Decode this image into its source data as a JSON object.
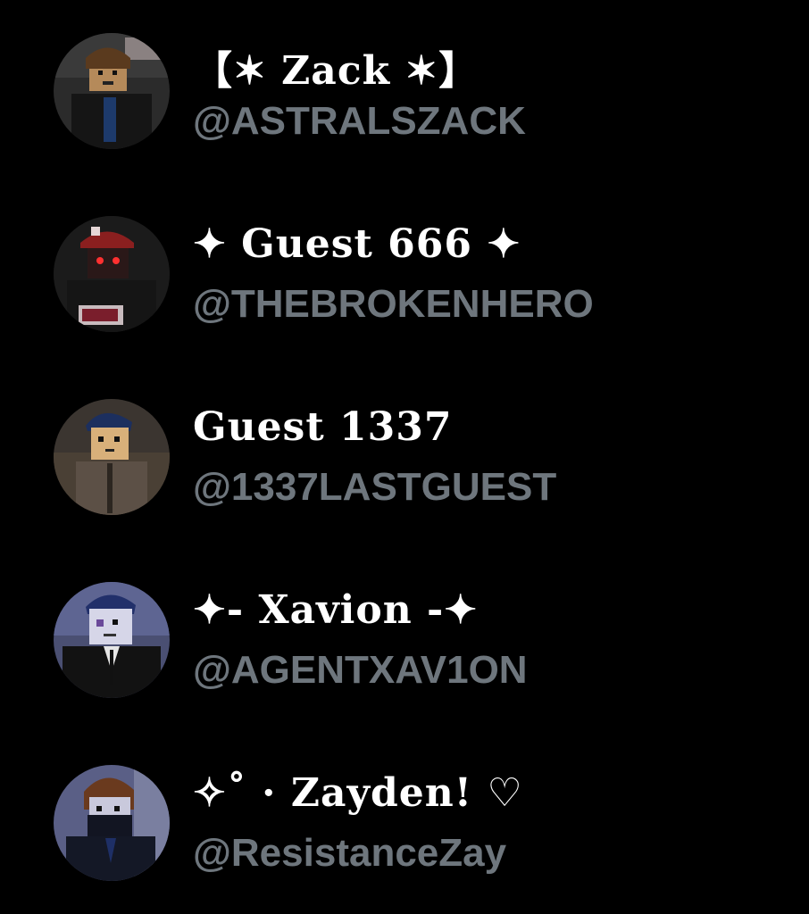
{
  "accounts": [
    {
      "display_name": "【✶ Zack ✶】",
      "handle": "@ASTRALSZACK",
      "avatar": "avatar-roblox-brown-hair"
    },
    {
      "display_name": "✦ Guest 666 ✦",
      "handle": "@THEBROKENHERO",
      "avatar": "avatar-roblox-red-cap"
    },
    {
      "display_name": "Guest 1337",
      "handle": "@1337LASTGUEST",
      "avatar": "avatar-roblox-blue-hair"
    },
    {
      "display_name": "✦- Xavion -✦",
      "handle": "@AGENTXAV1ON",
      "avatar": "avatar-roblox-agent-suit"
    },
    {
      "display_name": "✧˚ · Zayden! ♡",
      "handle": "@ResistanceZay",
      "avatar": "avatar-roblox-masked"
    }
  ],
  "colors": {
    "background": "#000000",
    "name": "#ffffff",
    "handle": "#6e767d"
  }
}
